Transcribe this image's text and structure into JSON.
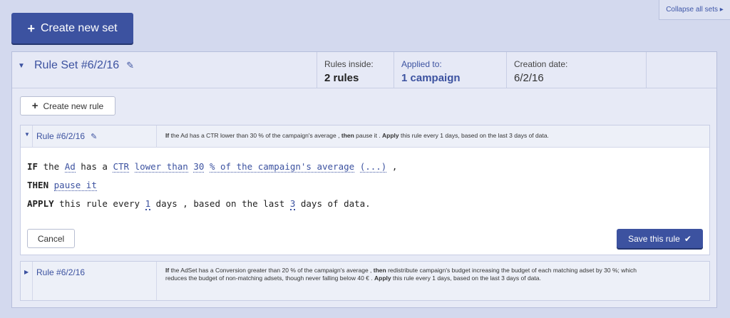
{
  "topbar": {
    "collapse_all": "Collapse all sets ▸",
    "create_set": "Create new set"
  },
  "ruleset": {
    "title": "Rule Set #6/2/16",
    "rules_inside_label": "Rules inside:",
    "rules_inside_value": "2 rules",
    "applied_label": "Applied to:",
    "applied_value": "1 campaign",
    "creation_label": "Creation date:",
    "creation_value": "6/2/16",
    "create_rule": "Create new rule"
  },
  "rule1": {
    "title": "Rule #6/2/16",
    "summary": [
      {
        "text": "If",
        "bold": true
      },
      {
        "text": " the Ad has a CTR lower than 30 % of the campaign's average , ",
        "bold": false
      },
      {
        "text": "then",
        "bold": true
      },
      {
        "text": " pause it . ",
        "bold": false
      },
      {
        "text": "Apply",
        "bold": true
      },
      {
        "text": " this rule every 1 days, based on the last 3 days of data.",
        "bold": false
      }
    ],
    "line1": {
      "if": "IF",
      "the": "the",
      "object": "Ad",
      "has_a": "has a",
      "metric": "CTR",
      "comparator": "lower than",
      "value": "30",
      "reference": "% of the campaign's average",
      "more": "(...)",
      "comma": ","
    },
    "line2": {
      "then": "THEN",
      "action": "pause it"
    },
    "line3": {
      "apply": "APPLY",
      "this_rule_every": "this rule every",
      "every_value": "1",
      "days_based": "days , based on the last",
      "last_value": "3",
      "days_of_data": "days of data."
    },
    "cancel": "Cancel",
    "save": "Save this rule"
  },
  "rule2": {
    "title": "Rule #6/2/16",
    "summary": [
      {
        "text": "If",
        "bold": true
      },
      {
        "text": " the AdSet has a Conversion greater than 20 % of the campaign's average , ",
        "bold": false
      },
      {
        "text": "then",
        "bold": true
      },
      {
        "text": " redistribute campaign's budget increasing the budget of each matching adset by 30 %; which reduces the budget of non-matching adsets, though never falling below 40 € . ",
        "bold": false
      },
      {
        "text": "Apply",
        "bold": true
      },
      {
        "text": " this rule every 1 days, based on the last 3 days of data.",
        "bold": false
      }
    ]
  }
}
